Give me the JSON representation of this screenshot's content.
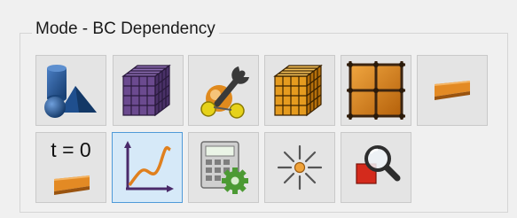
{
  "group": {
    "title": "Mode - BC Dependency"
  },
  "buttons": [
    {
      "name": "geometry-mode-button",
      "icon": "geometry-shapes-icon"
    },
    {
      "name": "mesh-mode-button",
      "icon": "purple-mesh-cube-icon"
    },
    {
      "name": "settings-mode-button",
      "icon": "wrench-settings-icon"
    },
    {
      "name": "structured-mesh-mode-button",
      "icon": "orange-mesh-cube-icon"
    },
    {
      "name": "grid-mode-button",
      "icon": "orange-grid-icon"
    },
    {
      "name": "boundary-condition-mode-button",
      "icon": "orange-bar-icon"
    },
    {
      "name": "initial-condition-button",
      "icon": "time-zero-bar-icon",
      "label": "t = 0"
    },
    {
      "name": "time-dependency-button",
      "icon": "curve-graph-icon",
      "active": true
    },
    {
      "name": "calculator-settings-button",
      "icon": "calculator-gear-icon"
    },
    {
      "name": "point-source-button",
      "icon": "starburst-point-icon"
    },
    {
      "name": "inspect-button",
      "icon": "magnifier-shape-icon"
    }
  ],
  "colors": {
    "panel_bg": "#f0f0f0",
    "button_bg": "#e4e4e4",
    "active_bg": "#d6e9f8",
    "active_border": "#4f9ad8",
    "accent_orange": "#e08a1e",
    "mesh_purple": "#5a3f7a",
    "shape_blue": "#1d4f8c"
  }
}
